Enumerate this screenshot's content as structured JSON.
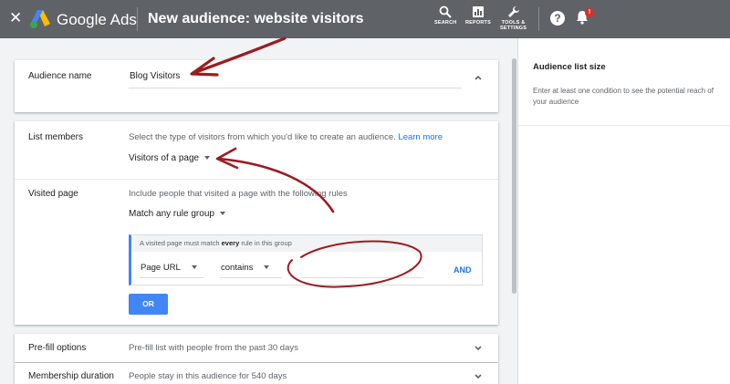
{
  "topbar": {
    "close_icon": "close-icon",
    "brand": "Google Ads",
    "title": "New audience: website visitors",
    "tools": [
      {
        "icon": "search-icon",
        "label": "SEARCH"
      },
      {
        "icon": "reports-icon",
        "label": "REPORTS"
      },
      {
        "icon": "wrench-icon",
        "label_line1": "TOOLS &",
        "label_line2": "SETTINGS"
      }
    ],
    "help_glyph": "?",
    "notification_badge": "!"
  },
  "audience_name": {
    "label": "Audience name",
    "value": "Blog Visitors"
  },
  "list_members": {
    "label": "List members",
    "description": "Select the type of visitors from which you'd like to create an audience.",
    "learn_more": "Learn more",
    "selected": "Visitors of a page"
  },
  "visited_page": {
    "label": "Visited page",
    "description": "Include people that visited a page with the following rules",
    "rule_group_selected": "Match any rule group",
    "rule_header_before": "A visited page must match",
    "rule_header_bold": "every",
    "rule_header_after": "rule in this group",
    "field_selected": "Page URL",
    "operator_selected": "contains",
    "value": "",
    "and_label": "AND",
    "or_label": "OR"
  },
  "prefill": {
    "label": "Pre-fill options",
    "summary": "Pre-fill list with people from the past 30 days"
  },
  "membership": {
    "label": "Membership duration",
    "summary": "People stay in this audience for 540 days"
  },
  "side_panel": {
    "title": "Audience list size",
    "text": "Enter at least one condition to see the potential reach of your audience"
  },
  "colors": {
    "topbar": "#5f6368",
    "accent_blue": "#4285f4",
    "link_blue": "#1a73e8",
    "annotation_red": "#9b1c20"
  }
}
